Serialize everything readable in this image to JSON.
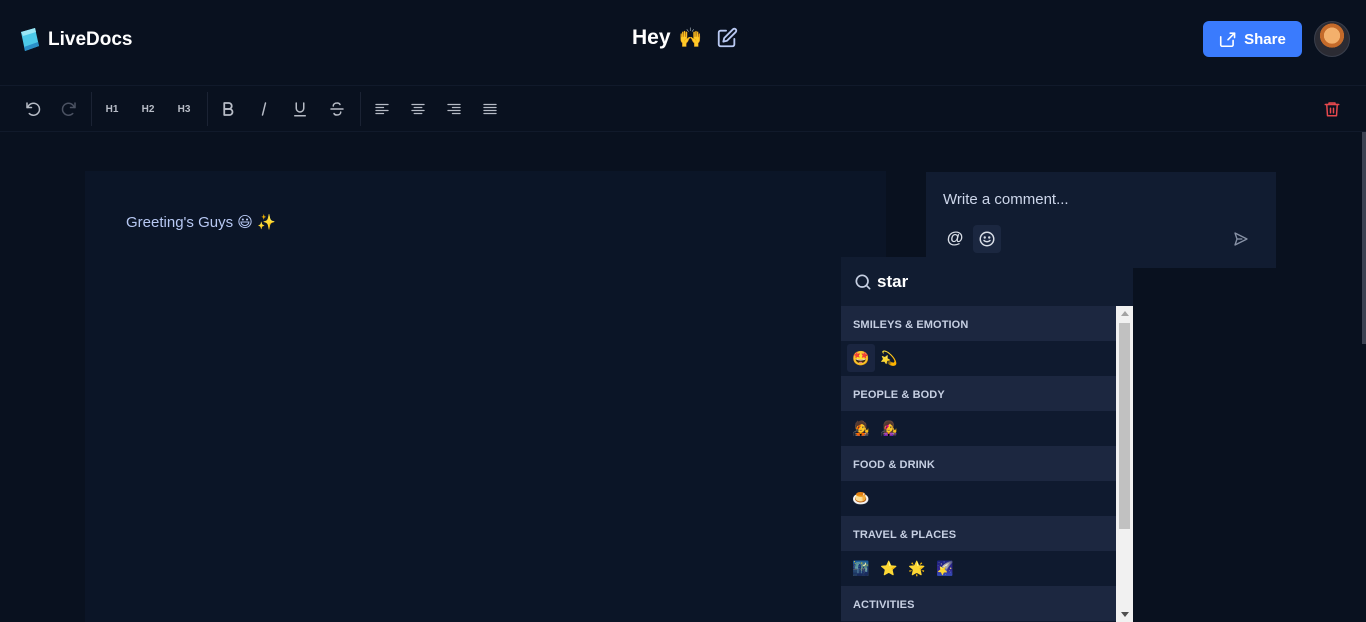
{
  "app": {
    "name": "LiveDocs"
  },
  "document": {
    "title": "Hey",
    "title_emoji": "🙌",
    "body_text": "Greeting's Guys",
    "body_emoji": "😃 ✨"
  },
  "header": {
    "share_label": "Share"
  },
  "toolbar": {
    "h1": "H1",
    "h2": "H2",
    "h3": "H3"
  },
  "comment": {
    "placeholder": "Write a comment...",
    "mention_symbol": "@"
  },
  "emoji_picker": {
    "search_value": "star",
    "categories": [
      {
        "title": "SMILEYS & EMOTION",
        "emojis": [
          "🤩",
          "💫"
        ]
      },
      {
        "title": "PEOPLE & BODY",
        "emojis": [
          "🧑‍🎤",
          "👩‍🎤"
        ]
      },
      {
        "title": "FOOD & DRINK",
        "emojis": [
          "🍮"
        ]
      },
      {
        "title": "TRAVEL & PLACES",
        "emojis": [
          "🌃",
          "⭐",
          "🌟",
          "🌠"
        ]
      },
      {
        "title": "ACTIVITIES",
        "emojis": []
      }
    ]
  },
  "colors": {
    "background": "#09111f",
    "editor": "#0b1527",
    "share_button": "#3a7bfd",
    "trash_icon": "#e5484d"
  },
  "icons": [
    "logo-icon",
    "edit-icon",
    "share-icon",
    "avatar",
    "undo-icon",
    "redo-icon",
    "bold-icon",
    "italic-icon",
    "underline-icon",
    "strikethrough-icon",
    "align-left-icon",
    "align-center-icon",
    "align-right-icon",
    "align-justify-icon",
    "trash-icon",
    "mention-icon",
    "emoji-icon",
    "send-icon",
    "search-icon"
  ]
}
